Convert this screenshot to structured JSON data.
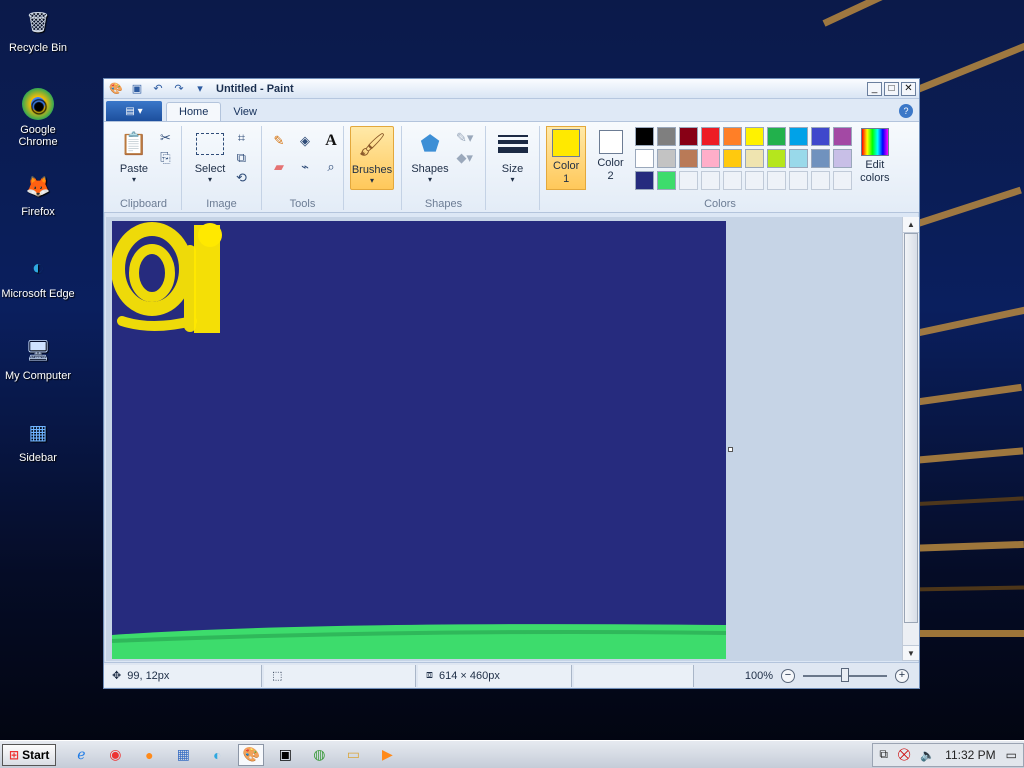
{
  "desktop": {
    "icons": [
      {
        "label": "Recycle Bin",
        "glyph": "🗑"
      },
      {
        "label": "Google Chrome",
        "glyph": "◉"
      },
      {
        "label": "Firefox",
        "glyph": "🦊"
      },
      {
        "label": "Microsoft Edge",
        "glyph": "◐"
      },
      {
        "label": "My Computer",
        "glyph": "🖥"
      },
      {
        "label": "Sidebar",
        "glyph": "▦"
      }
    ]
  },
  "window": {
    "title": "Untitled - Paint",
    "controls": {
      "minimize": "_",
      "maximize": "□",
      "close": "✕"
    }
  },
  "tabs": [
    {
      "label": "Home",
      "active": true
    },
    {
      "label": "View",
      "active": false
    }
  ],
  "help": "?",
  "ribbon": {
    "clipboard": {
      "label": "Clipboard",
      "paste": "Paste"
    },
    "image": {
      "label": "Image",
      "select": "Select"
    },
    "tools": {
      "label": "Tools"
    },
    "brushes": {
      "label": "Brushes"
    },
    "shapes": {
      "label": "Shapes",
      "button": "Shapes"
    },
    "size": {
      "label": "Size"
    },
    "colors": {
      "label": "Colors",
      "color1": {
        "line1": "Color",
        "line2": "1",
        "value": "#ffe900"
      },
      "color2": {
        "line1": "Color",
        "line2": "2",
        "value": "#ffffff"
      },
      "edit_line1": "Edit",
      "edit_line2": "colors",
      "palette_row1": [
        "#000000",
        "#7f7f7f",
        "#880015",
        "#ed1c24",
        "#ff7f27",
        "#fff200",
        "#22b14c",
        "#00a2e8",
        "#3f48cc",
        "#a349a4"
      ],
      "palette_row2": [
        "#ffffff",
        "#c3c3c3",
        "#b97a57",
        "#ffaec9",
        "#ffc90e",
        "#efe4b0",
        "#b5e61d",
        "#99d9ea",
        "#7092be",
        "#c8bfe7"
      ],
      "palette_row3": [
        "#262b7e",
        "#3ddc6c"
      ]
    }
  },
  "canvas": {
    "background": "#262b7e"
  },
  "status": {
    "cursor_pos": "99, 12px",
    "selection_size": "",
    "canvas_size": "614 × 460px",
    "zoom": "100%"
  },
  "taskbar": {
    "start": "Start",
    "clock": "11:32 PM"
  }
}
